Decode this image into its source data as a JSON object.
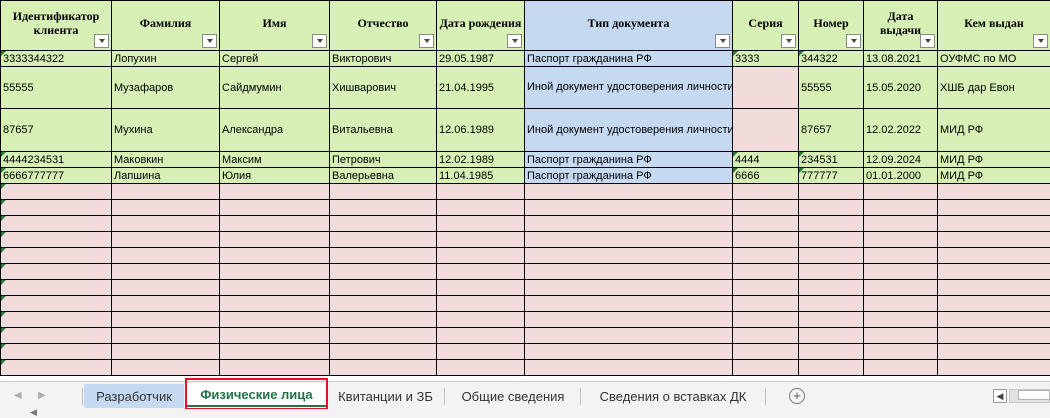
{
  "headers": [
    "Идентификатор клиента",
    "Фамилия",
    "Имя",
    "Отчество",
    "Дата рождения",
    "Тип документа",
    "Серия",
    "Номер",
    "Дата выдачи",
    "Кем выдан"
  ],
  "rows": [
    [
      "3333344322",
      "Лопухин",
      "Сергей",
      "Викторович",
      "29.05.1987",
      "Паспорт гражданина РФ",
      "3333",
      "344322",
      "13.08.2021",
      "ОУФМС по МО"
    ],
    [
      "55555",
      "Музафаров",
      "Сайдмумин",
      "Хишварович",
      "21.04.1995",
      "Иной документ удостоверения личности иностранного гражданина (лица без гражданства)",
      "",
      "55555",
      "15.05.2020",
      "ХШБ дар Евон"
    ],
    [
      "87657",
      "Мухина",
      "Александра",
      "Витальевна",
      "12.06.1989",
      "Иной документ удостоверения личности иностранного гражданина (лица без гражданства)",
      "",
      "87657",
      "12.02.2022",
      "МИД РФ"
    ],
    [
      "4444234531",
      "Маковкин",
      "Максим",
      "Петрович",
      "12.02.1989",
      "Паспорт гражданина РФ",
      "4444",
      "234531",
      "12.09.2024",
      "МИД РФ"
    ],
    [
      "6666777777",
      "Лапшина",
      "Юлия",
      "Валерьевна",
      "11.04.1985",
      "Паспорт гражданина РФ",
      "6666",
      "777777",
      "01.01.2000",
      "МИД РФ"
    ]
  ],
  "empty_row_count": 12,
  "tabs": [
    "Разработчик",
    "Физические лица",
    "Квитанции и ЗБ",
    "Общие сведения",
    "Сведения о вставках ДК"
  ],
  "active_tab": "Физические лица",
  "icons": {
    "add_sheet": "+",
    "prev_sheet": "◀",
    "next_sheet": "▶",
    "scroll_left": "◀",
    "status_arrow": "◀"
  },
  "colors": {
    "header_green": "#d7f0b6",
    "header_blue": "#c5d9f1",
    "empty_pink": "#f2dcdb",
    "active_tab_text": "#217346",
    "highlight_red": "#e81123"
  }
}
